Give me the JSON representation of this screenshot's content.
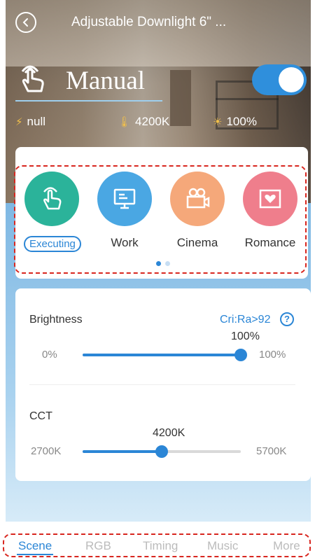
{
  "header": {
    "title": "Adjustable Downlight 6\" ..."
  },
  "mode": {
    "label": "Manual",
    "toggle_on": true
  },
  "stats": {
    "effect": "null",
    "cct": "4200K",
    "brightness": "100%"
  },
  "scenes": {
    "items": [
      {
        "label": "Executing",
        "active": true,
        "color": "#2bb39a",
        "icon": "hand-icon"
      },
      {
        "label": "Work",
        "active": false,
        "color": "#4aa7e3",
        "icon": "monitor-icon"
      },
      {
        "label": "Cinema",
        "active": false,
        "color": "#f5a87a",
        "icon": "camera-icon"
      },
      {
        "label": "Romance",
        "active": false,
        "color": "#ef7e8c",
        "icon": "heart-photo-icon"
      }
    ],
    "pages": 2,
    "current_page": 1
  },
  "brightness": {
    "title": "Brightness",
    "cri": "Cri:Ra>92",
    "help": "?",
    "min_label": "0%",
    "max_label": "100%",
    "value_label": "100%",
    "value": 100
  },
  "cct": {
    "title": "CCT",
    "min_label": "2700K",
    "max_label": "5700K",
    "value_label": "4200K",
    "value": 4200,
    "min": 2700,
    "max": 5700
  },
  "tabs": [
    {
      "label": "Scene",
      "active": true
    },
    {
      "label": "RGB",
      "active": false
    },
    {
      "label": "Timing",
      "active": false
    },
    {
      "label": "Music",
      "active": false
    },
    {
      "label": "More",
      "active": false
    }
  ],
  "colors": {
    "accent": "#2b86d6",
    "annotation": "#d8261f"
  }
}
